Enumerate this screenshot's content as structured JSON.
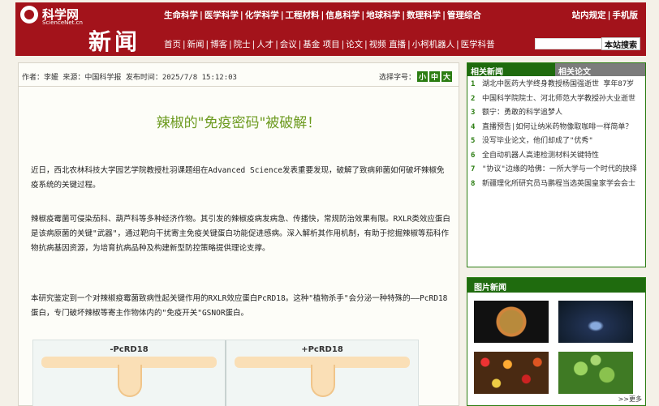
{
  "header": {
    "logo_text": "科学网",
    "logo_url": "ScienceNet.cn",
    "section_name": "新闻",
    "top_nav": [
      "生命科学",
      "医学科学",
      "化学科学",
      "工程材料",
      "信息科学",
      "地球科学",
      "数理科学",
      "管理综合"
    ],
    "sub_nav": [
      "首页",
      "新闻",
      "博客",
      "院士",
      "人才",
      "会议",
      "基金",
      "项目",
      "论文",
      "视频",
      "直播",
      "小柯机器人",
      "医学科普"
    ],
    "site_links": [
      "站内规定",
      "手机版"
    ],
    "search_button": "本站搜索",
    "search_value": ""
  },
  "article": {
    "meta": "作者：李媛 来源：中国科学报 发布时间：2025/7/8 15:12:03",
    "font_size_label": "选择字号：",
    "font_sizes": [
      "小",
      "中",
      "大"
    ],
    "headline": "辣椒的\"免疫密码\"被破解！",
    "para1": "近日，西北农林科技大学园艺学院教授杜羽课题组在Advanced Science发表重要发现，破解了致病卵菌如何破坏辣椒免疫系统的关键过程。",
    "para2": "辣椒疫霉菌可侵染茄科、葫芦科等多种经济作物。其引发的辣椒疫病发病急、传播快，常规防治效果有限。RXLR类效应蛋白是该病原菌的关键\"武器\"，通过靶向干扰寄主免疫关键蛋白功能促进感病。深入解析其作用机制，有助于挖掘辣椒等茄科作物抗病基因资源，为培育抗病品种及构建新型防控策略提供理论支撑。",
    "para3": "本研究鉴定到一个对辣椒疫霉菌致病性起关键作用的RXLR效应蛋白PcRD18。这种\"植物杀手\"会分泌一种特殊的——PcRD18蛋白，专门破坏辣椒等寄主作物体内的\"免疫开关\"GSNOR蛋白。",
    "figure_labels": [
      "-PcRD18",
      "+PcRD18"
    ]
  },
  "related": {
    "tabs": [
      "相关新闻",
      "相关论文"
    ],
    "items": [
      {
        "num": "1",
        "title": "湖北中医药大学终身教授杨国强逝世 享年87岁"
      },
      {
        "num": "2",
        "title": "中国科学院院士、河北师范大学教授孙大业逝世"
      },
      {
        "num": "3",
        "title": "额宁：勇敢的科学追梦人"
      },
      {
        "num": "4",
        "title": "直播预告|如何让纳米药物像取咖啡一样简单？"
      },
      {
        "num": "5",
        "title": "没写毕业论文，他们却成了\"优秀\""
      },
      {
        "num": "6",
        "title": "全自动机器人高速检测材料关键特性"
      },
      {
        "num": "7",
        "title": "\"协议\"边缘的哈佛：一所大学与一个时代的抉择"
      },
      {
        "num": "8",
        "title": "新疆理化所研究员马鹏程当选英国皇家学会会士"
      }
    ]
  },
  "photo_news": {
    "title": "图片新闻",
    "more": ">>更多"
  }
}
